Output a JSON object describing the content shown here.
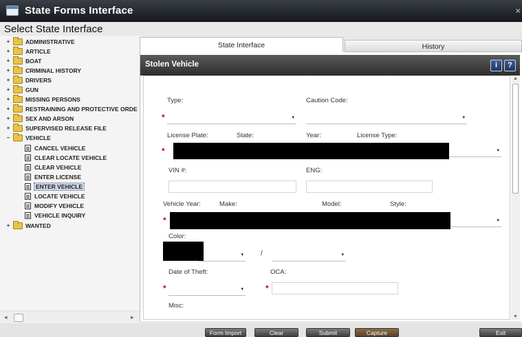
{
  "window": {
    "title": "State Forms Interface",
    "close_glyph": "×"
  },
  "header": {
    "title": "Select State Interface"
  },
  "tree": {
    "expanded_glyph": "−",
    "collapsed_glyph": "+",
    "folders": [
      "ADMINISTRATIVE",
      "ARTICLE",
      "BOAT",
      "CRIMINAL HISTORY",
      "DRIVERS",
      "GUN",
      "MISSING PERSONS",
      "RESTRAINING AND PROTECTIVE ORDE",
      "SEX AND ARSON",
      "SUPERVISED RELEASE FILE",
      "VEHICLE"
    ],
    "vehicle_items": [
      "CANCEL VEHICLE",
      "CLEAR LOCATE VEHICLE",
      "CLEAR VEHICLE",
      "ENTER LICENSE",
      "ENTER VEHICLE",
      "LOCATE VEHICLE",
      "MODIFY VEHICLE",
      "VEHICLE INQUIRY"
    ],
    "selected_item": "ENTER VEHICLE",
    "last_folder": "WANTED"
  },
  "tabs": {
    "state_interface": "State Interface",
    "history": "History"
  },
  "panel": {
    "title": "Stolen Vehicle",
    "info_glyph": "i",
    "help_glyph": "?",
    "required_mark": "*",
    "dropdown_glyph": "▾",
    "labels": {
      "type": "Type:",
      "caution_code": "Caution Code:",
      "license_plate": "License Plate:",
      "state": "State:",
      "year": "Year:",
      "license_type": "License Type:",
      "vin": "VIN #:",
      "eng": "ENG:",
      "vehicle_year": "Vehicle Year:",
      "make": "Make:",
      "model": "Model:",
      "style": "Style:",
      "color": "Color:",
      "color_separator": "/",
      "date_of_theft": "Date of Theft:",
      "oca": "OCA:",
      "misc": "Misc:"
    }
  },
  "buttons": {
    "form_import": "Form Import",
    "clear": "Clear",
    "submit": "Submit",
    "capture": "Capture",
    "exit": "Exit"
  }
}
